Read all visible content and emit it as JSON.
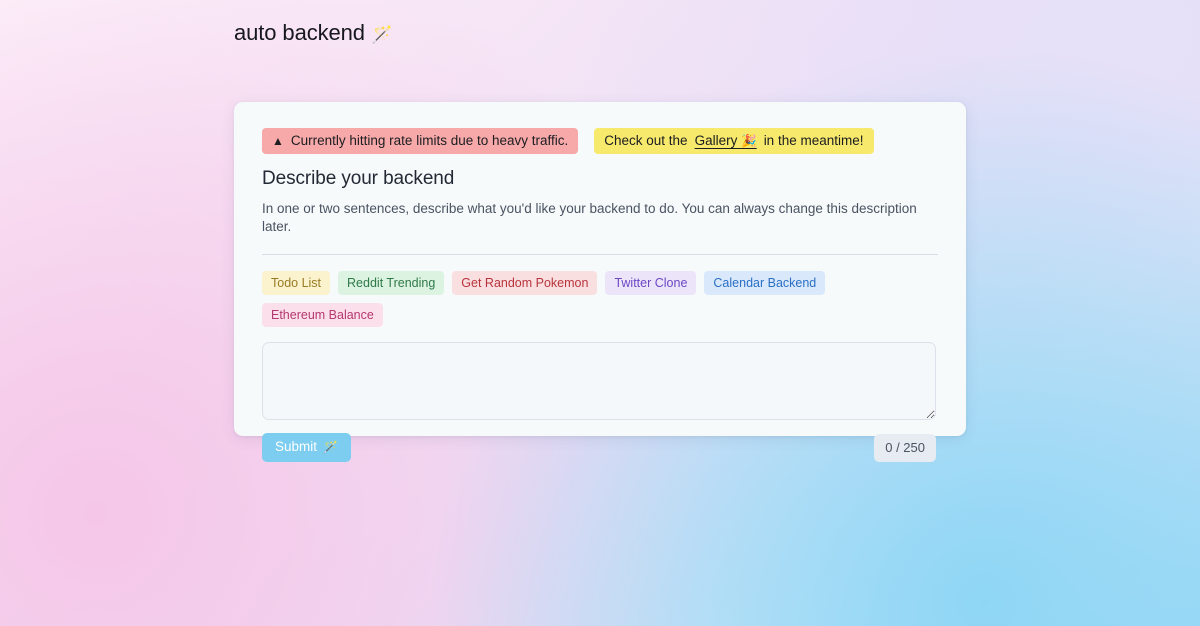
{
  "header": {
    "brand_title": "auto backend",
    "brand_icon": "🪄"
  },
  "banners": {
    "warning": {
      "icon": "▲",
      "text": "Currently hitting rate limits due to heavy traffic.",
      "bg": "#f7a8a8"
    },
    "info": {
      "prefix": "Check out the",
      "link_text": "Gallery",
      "link_icon": "🎉",
      "suffix": "in the meantime!",
      "bg": "#f7e96b"
    }
  },
  "form": {
    "title": "Describe your backend",
    "description": "In one or two sentences, describe what you'd like your backend to do. You can always change this description later.",
    "textarea_value": "",
    "textarea_placeholder": "",
    "submit_label": "Submit",
    "submit_icon": "🪄",
    "char_counter": "0 / 250"
  },
  "suggestions": [
    {
      "label": "Todo List",
      "bg": "#faf3cd",
      "color": "#9a7b25"
    },
    {
      "label": "Reddit Trending",
      "bg": "#ddf3e2",
      "color": "#2f7a49"
    },
    {
      "label": "Get Random Pokemon",
      "bg": "#fadfe0",
      "color": "#b8343c"
    },
    {
      "label": "Twitter Clone",
      "bg": "#ece5fa",
      "color": "#6b47c4"
    },
    {
      "label": "Calendar Backend",
      "bg": "#d9e9fb",
      "color": "#2b6fc4"
    },
    {
      "label": "Ethereum Balance",
      "bg": "#fbe0ec",
      "color": "#b5376f"
    }
  ]
}
